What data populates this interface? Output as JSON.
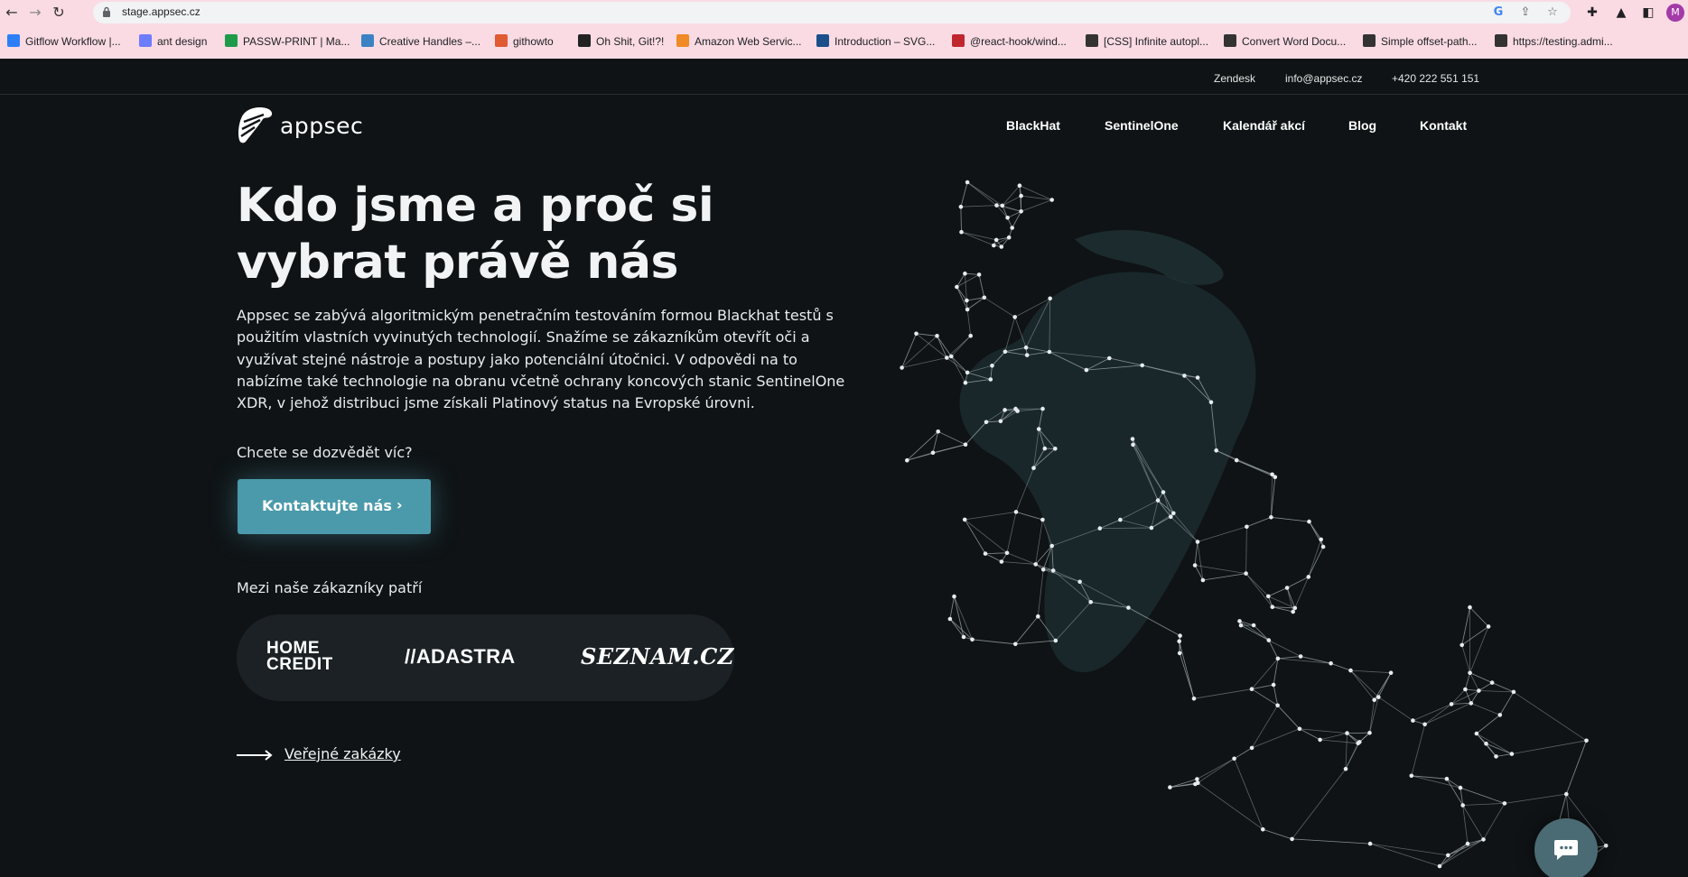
{
  "browser": {
    "url": "stage.appsec.cz",
    "profile_initial": "M",
    "bookmarks": [
      {
        "label": "Gitflow Workflow |...",
        "color": "#2d7ff9"
      },
      {
        "label": "ant design",
        "color": "#6e7cff"
      },
      {
        "label": "PASSW-PRINT | Ma...",
        "color": "#1e9b4a"
      },
      {
        "label": "Creative Handles –...",
        "color": "#3b82c4"
      },
      {
        "label": "githowto",
        "color": "#e05a32"
      },
      {
        "label": "Oh Shit, Git!?!",
        "color": "#222222"
      },
      {
        "label": "Amazon Web Servic...",
        "color": "#f08a24"
      },
      {
        "label": "Introduction – SVG...",
        "color": "#1b4f8a"
      },
      {
        "label": "@react-hook/wind...",
        "color": "#c0262d"
      },
      {
        "label": "[CSS] Infinite autopl...",
        "color": "#333333"
      },
      {
        "label": "Convert Word Docu...",
        "color": "#333333"
      },
      {
        "label": "Simple offset-path...",
        "color": "#333333"
      },
      {
        "label": "https://testing.admi...",
        "color": "#333333"
      }
    ]
  },
  "topbar": {
    "zendesk": "Zendesk",
    "email": "info@appsec.cz",
    "phone": "+420 222 551 151"
  },
  "logo": {
    "text": "appsec"
  },
  "nav": {
    "blackhat": "BlackHat",
    "sentinelone": "SentinelOne",
    "calendar": "Kalendář akcí",
    "blog": "Blog",
    "contact": "Kontakt"
  },
  "hero": {
    "title_line1": "Kdo jsme a proč si",
    "title_line2": "vybrat právě nás",
    "intro_lines": [
      "Appsec se zabývá algoritmickým penetračním testováním formou Blackhat testů s",
      "použitím vlastních vyvinutých technologií. Snažíme se zákazníkům otevřít oči a",
      "využívat stejné nástroje a postupy jako potenciální útočnici. V odpovědi na to",
      "nabízíme také technologie na obranu včetně ochrany koncových stanic SentinelOne",
      "XDR, v jehož distribuci jsme získali Platinový status na Evropské úrovni."
    ],
    "question": "Chcete se dozvědět víc?",
    "cta_label": "Kontaktujte nás",
    "customers_label": "Mezi naše zákazníky patří",
    "customers": {
      "homecredit_line1": "HOME",
      "homecredit_line2": "CREDIT",
      "adastra": "//ADASTRA",
      "seznam": "SEZNAM.CZ"
    },
    "tender_link": "Veřejné zakázky"
  },
  "colors": {
    "background": "#0f1315",
    "accent": "#4b9aab",
    "chat_button": "#4a6b74",
    "browser_chrome": "#fadbe4"
  }
}
